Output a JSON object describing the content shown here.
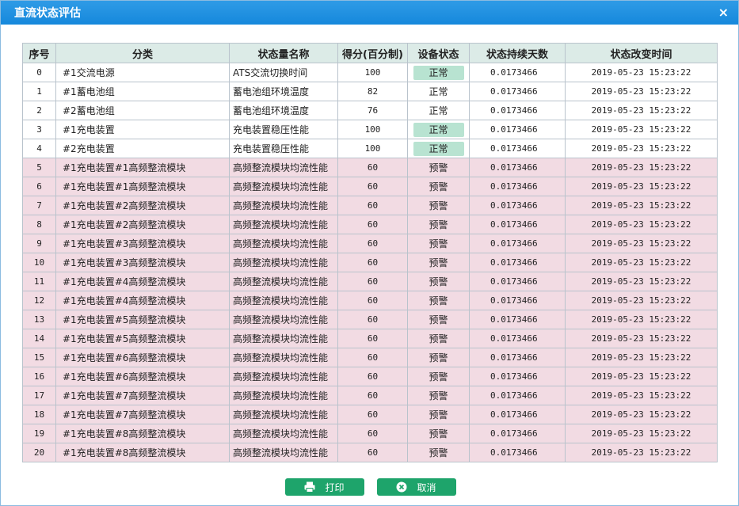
{
  "dialog": {
    "title": "直流状态评估",
    "close_symbol": "×"
  },
  "table": {
    "headers": [
      "序号",
      "分类",
      "状态量名称",
      "得分(百分制)",
      "设备状态",
      "状态持续天数",
      "状态改变时间"
    ],
    "rows": [
      {
        "idx": "0",
        "category": "#1交流电源",
        "name": "ATS交流切换时间",
        "score": "100",
        "status": "正常",
        "days": "0.0173466",
        "time": "2019-05-23 15:23:22",
        "level": "ok"
      },
      {
        "idx": "1",
        "category": "#1蓄电池组",
        "name": "蓄电池组环境温度",
        "score": "82",
        "status": "正常",
        "days": "0.0173466",
        "time": "2019-05-23 15:23:22",
        "level": "plain"
      },
      {
        "idx": "2",
        "category": "#2蓄电池组",
        "name": "蓄电池组环境温度",
        "score": "76",
        "status": "正常",
        "days": "0.0173466",
        "time": "2019-05-23 15:23:22",
        "level": "plain"
      },
      {
        "idx": "3",
        "category": "#1充电装置",
        "name": "充电装置稳压性能",
        "score": "100",
        "status": "正常",
        "days": "0.0173466",
        "time": "2019-05-23 15:23:22",
        "level": "ok"
      },
      {
        "idx": "4",
        "category": "#2充电装置",
        "name": "充电装置稳压性能",
        "score": "100",
        "status": "正常",
        "days": "0.0173466",
        "time": "2019-05-23 15:23:22",
        "level": "ok"
      },
      {
        "idx": "5",
        "category": "#1充电装置#1高频整流模块",
        "name": "高频整流模块均流性能",
        "score": "60",
        "status": "预警",
        "days": "0.0173466",
        "time": "2019-05-23 15:23:22",
        "level": "warn"
      },
      {
        "idx": "6",
        "category": "#1充电装置#1高频整流模块",
        "name": "高频整流模块均流性能",
        "score": "60",
        "status": "预警",
        "days": "0.0173466",
        "time": "2019-05-23 15:23:22",
        "level": "warn"
      },
      {
        "idx": "7",
        "category": "#1充电装置#2高频整流模块",
        "name": "高频整流模块均流性能",
        "score": "60",
        "status": "预警",
        "days": "0.0173466",
        "time": "2019-05-23 15:23:22",
        "level": "warn"
      },
      {
        "idx": "8",
        "category": "#1充电装置#2高频整流模块",
        "name": "高频整流模块均流性能",
        "score": "60",
        "status": "预警",
        "days": "0.0173466",
        "time": "2019-05-23 15:23:22",
        "level": "warn"
      },
      {
        "idx": "9",
        "category": "#1充电装置#3高频整流模块",
        "name": "高频整流模块均流性能",
        "score": "60",
        "status": "预警",
        "days": "0.0173466",
        "time": "2019-05-23 15:23:22",
        "level": "warn"
      },
      {
        "idx": "10",
        "category": "#1充电装置#3高频整流模块",
        "name": "高频整流模块均流性能",
        "score": "60",
        "status": "预警",
        "days": "0.0173466",
        "time": "2019-05-23 15:23:22",
        "level": "warn"
      },
      {
        "idx": "11",
        "category": "#1充电装置#4高频整流模块",
        "name": "高频整流模块均流性能",
        "score": "60",
        "status": "预警",
        "days": "0.0173466",
        "time": "2019-05-23 15:23:22",
        "level": "warn"
      },
      {
        "idx": "12",
        "category": "#1充电装置#4高频整流模块",
        "name": "高频整流模块均流性能",
        "score": "60",
        "status": "预警",
        "days": "0.0173466",
        "time": "2019-05-23 15:23:22",
        "level": "warn"
      },
      {
        "idx": "13",
        "category": "#1充电装置#5高频整流模块",
        "name": "高频整流模块均流性能",
        "score": "60",
        "status": "预警",
        "days": "0.0173466",
        "time": "2019-05-23 15:23:22",
        "level": "warn"
      },
      {
        "idx": "14",
        "category": "#1充电装置#5高频整流模块",
        "name": "高频整流模块均流性能",
        "score": "60",
        "status": "预警",
        "days": "0.0173466",
        "time": "2019-05-23 15:23:22",
        "level": "warn"
      },
      {
        "idx": "15",
        "category": "#1充电装置#6高频整流模块",
        "name": "高频整流模块均流性能",
        "score": "60",
        "status": "预警",
        "days": "0.0173466",
        "time": "2019-05-23 15:23:22",
        "level": "warn"
      },
      {
        "idx": "16",
        "category": "#1充电装置#6高频整流模块",
        "name": "高频整流模块均流性能",
        "score": "60",
        "status": "预警",
        "days": "0.0173466",
        "time": "2019-05-23 15:23:22",
        "level": "warn"
      },
      {
        "idx": "17",
        "category": "#1充电装置#7高频整流模块",
        "name": "高频整流模块均流性能",
        "score": "60",
        "status": "预警",
        "days": "0.0173466",
        "time": "2019-05-23 15:23:22",
        "level": "warn"
      },
      {
        "idx": "18",
        "category": "#1充电装置#7高频整流模块",
        "name": "高频整流模块均流性能",
        "score": "60",
        "status": "预警",
        "days": "0.0173466",
        "time": "2019-05-23 15:23:22",
        "level": "warn"
      },
      {
        "idx": "19",
        "category": "#1充电装置#8高频整流模块",
        "name": "高频整流模块均流性能",
        "score": "60",
        "status": "预警",
        "days": "0.0173466",
        "time": "2019-05-23 15:23:22",
        "level": "warn"
      },
      {
        "idx": "20",
        "category": "#1充电装置#8高频整流模块",
        "name": "高频整流模块均流性能",
        "score": "60",
        "status": "预警",
        "days": "0.0173466",
        "time": "2019-05-23 15:23:22",
        "level": "warn"
      }
    ]
  },
  "footer": {
    "print_label": "打印",
    "cancel_label": "取消",
    "print_icon": "printer-icon",
    "cancel_icon": "close-circle-icon"
  },
  "colors": {
    "titlebar": "#1588dc",
    "header_bg": "#dcebe7",
    "warn_row": "#f2dbe3",
    "ok_badge": "#b8e3d1",
    "button": "#1ea46b"
  }
}
